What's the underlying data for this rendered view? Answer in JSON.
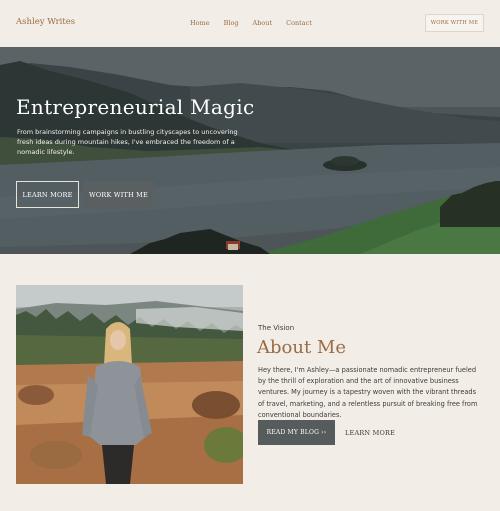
{
  "header": {
    "logo": "Ashley Writes",
    "nav": [
      "Home",
      "Blog",
      "About",
      "Contact"
    ],
    "cta": "WORK WITH ME"
  },
  "hero": {
    "title": "Entrepreneurial Magic",
    "text": "From brainstorming campaigns in bustling cityscapes to uncovering fresh ideas during mountain hikes, I've embraced the freedom of a nomadic lifestyle.",
    "primary_button": "LEARN MORE",
    "secondary_button": "WORK WITH ME"
  },
  "about": {
    "eyebrow": "The Vision",
    "title": "About Me",
    "text": "Hey there, I'm Ashley—a passionate nomadic entrepreneur fueled by the thrill of exploration and the art of innovative business ventures. My journey is a tapestry woven with the vibrant threads of travel, marketing, and a relentless pursuit of breaking free from conventional boundaries.",
    "blog_button": "READ MY BLOG ››",
    "learn_button": "LEARN MORE"
  },
  "colors": {
    "background": "#f2eee7",
    "accent": "#9b6b43",
    "dark_button": "#565b5c",
    "text": "#3e3a36"
  }
}
